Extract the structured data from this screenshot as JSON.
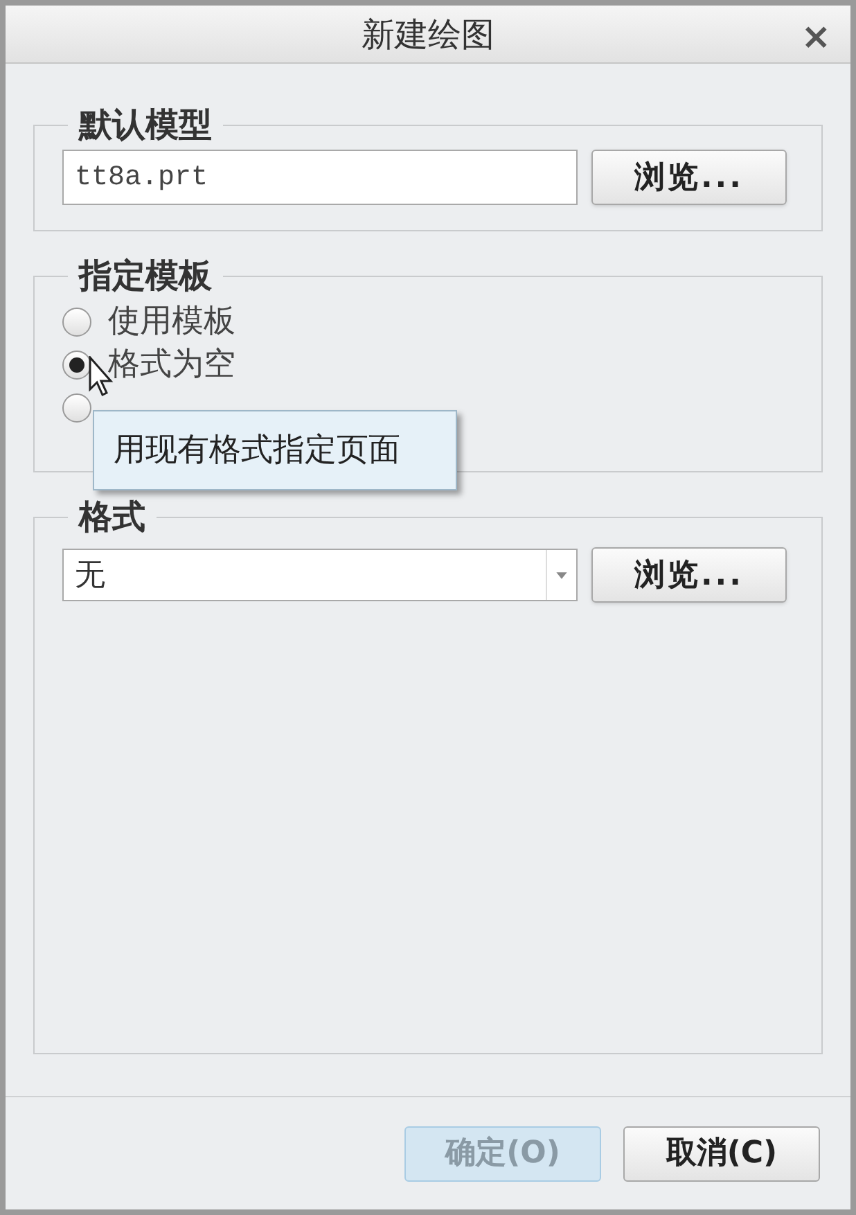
{
  "window": {
    "title": "新建绘图",
    "close": "×"
  },
  "default_model": {
    "legend": "默认模型",
    "value": "tt8a.prt",
    "browse": "浏览..."
  },
  "template": {
    "legend": "指定模板",
    "options": [
      {
        "label": "使用模板",
        "selected": false
      },
      {
        "label": "格式为空",
        "selected": true
      },
      {
        "selected": false
      }
    ]
  },
  "tooltip": "用现有格式指定页面",
  "format": {
    "legend": "格式",
    "value": "无",
    "browse": "浏览..."
  },
  "buttons": [
    {
      "label": "确定(O)",
      "disabled": true
    },
    {
      "label": "取消(C)",
      "disabled": false
    }
  ]
}
